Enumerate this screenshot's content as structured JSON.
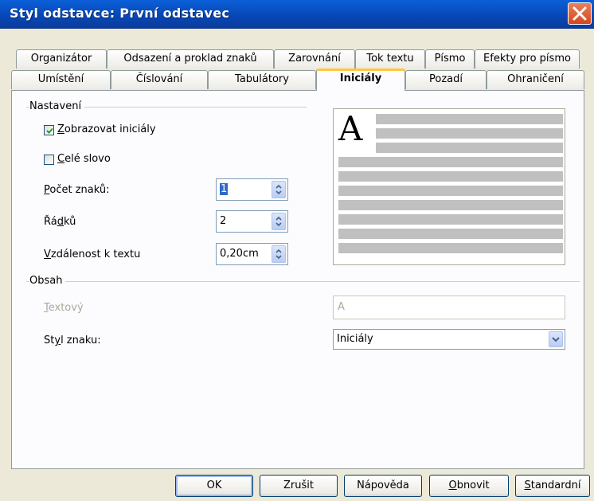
{
  "window": {
    "title": "Styl odstavce: První odstavec"
  },
  "tabs_row_back": [
    "Organizátor",
    "Odsazení a proklad znaků",
    "Zarovnání",
    "Tok textu",
    "Písmo",
    "Efekty pro písmo"
  ],
  "tabs_row_front": [
    "Umístění",
    "Číslování",
    "Tabulátory",
    "Iniciály",
    "Pozadí",
    "Ohraničení"
  ],
  "active_tab": "Iniciály",
  "settings": {
    "section": "Nastavení",
    "show_initials": {
      "hotkey": "Z",
      "rest": "obrazovat iniciály",
      "checked": true
    },
    "whole_word": {
      "hotkey": "C",
      "rest": "elé slovo",
      "checked": false
    },
    "char_count": {
      "pre": "",
      "hotkey": "P",
      "post": "očet znaků:",
      "value": "1"
    },
    "lines": {
      "pre": "Řá",
      "hotkey": "d",
      "post": "ků",
      "value": "2"
    },
    "distance": {
      "pre": "",
      "hotkey": "V",
      "post": "zdálenost k textu",
      "value": "0,20cm"
    }
  },
  "preview": {
    "initial_letter": "A"
  },
  "content": {
    "section": "Obsah",
    "text": {
      "hotkey": "T",
      "rest": "extový",
      "value": "A"
    },
    "char_style": {
      "pre": "St",
      "hotkey": "y",
      "post": "l znaku:",
      "value": "Iniciály"
    }
  },
  "buttons": {
    "ok": "OK",
    "cancel": "Zrušit",
    "help": "Nápověda",
    "reset": {
      "hotkey": "O",
      "rest": "bnovit"
    },
    "standard": {
      "hotkey": "S",
      "rest": "tandardní"
    }
  }
}
